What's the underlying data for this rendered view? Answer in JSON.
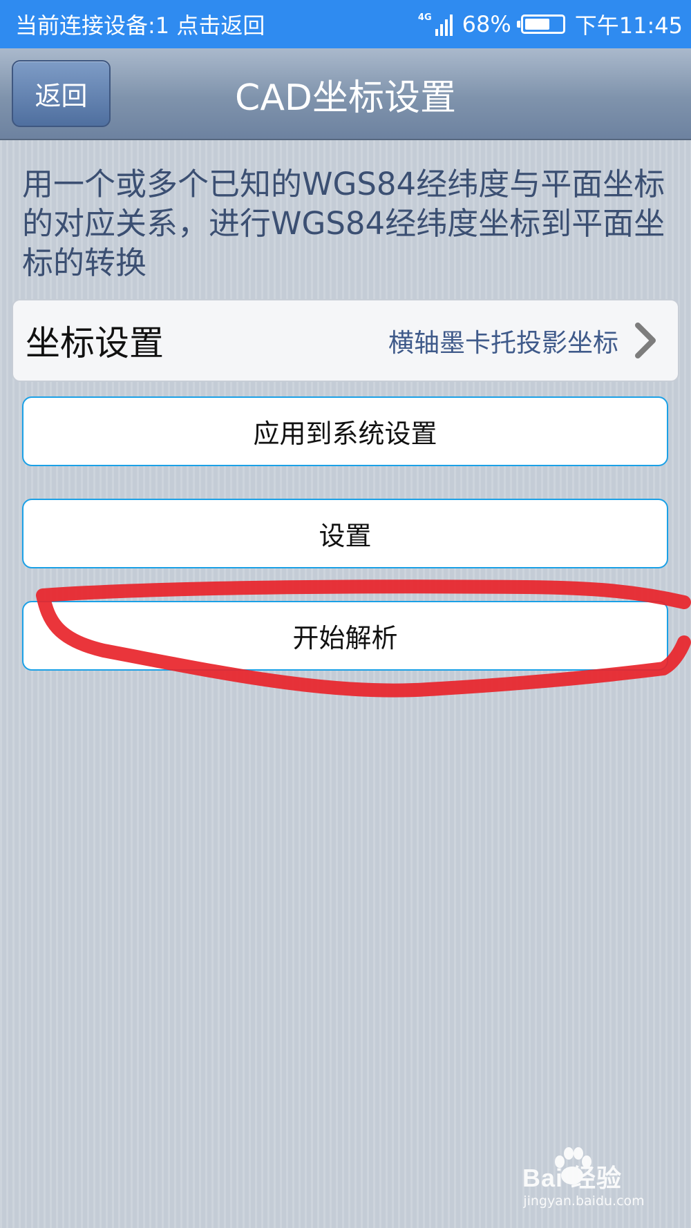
{
  "status_bar": {
    "left_text": "当前连接设备:1  点击返回",
    "network": "4G",
    "battery": "68%",
    "battery_level": 0.68,
    "time": "下午11:45"
  },
  "header": {
    "back_label": "返回",
    "title": "CAD坐标设置"
  },
  "description": "用一个或多个已知的WGS84经纬度与平面坐标的对应关系，进行WGS84经纬度坐标到平面坐标的转换",
  "coordinate_setting": {
    "label": "坐标设置",
    "value": "横轴墨卡托投影坐标",
    "icon": "chevron-right-icon"
  },
  "buttons": {
    "apply": "应用到系统设置",
    "settings": "设置",
    "start": "开始解析"
  },
  "annotation": {
    "color": "#e8242a"
  },
  "watermark": {
    "brand": "Bai 经验",
    "url": "jingyan.baidu.com"
  },
  "colors": {
    "status_bar": "#2f8bf0",
    "button_border": "#1aa0e6",
    "description_text": "#3b4f72"
  }
}
